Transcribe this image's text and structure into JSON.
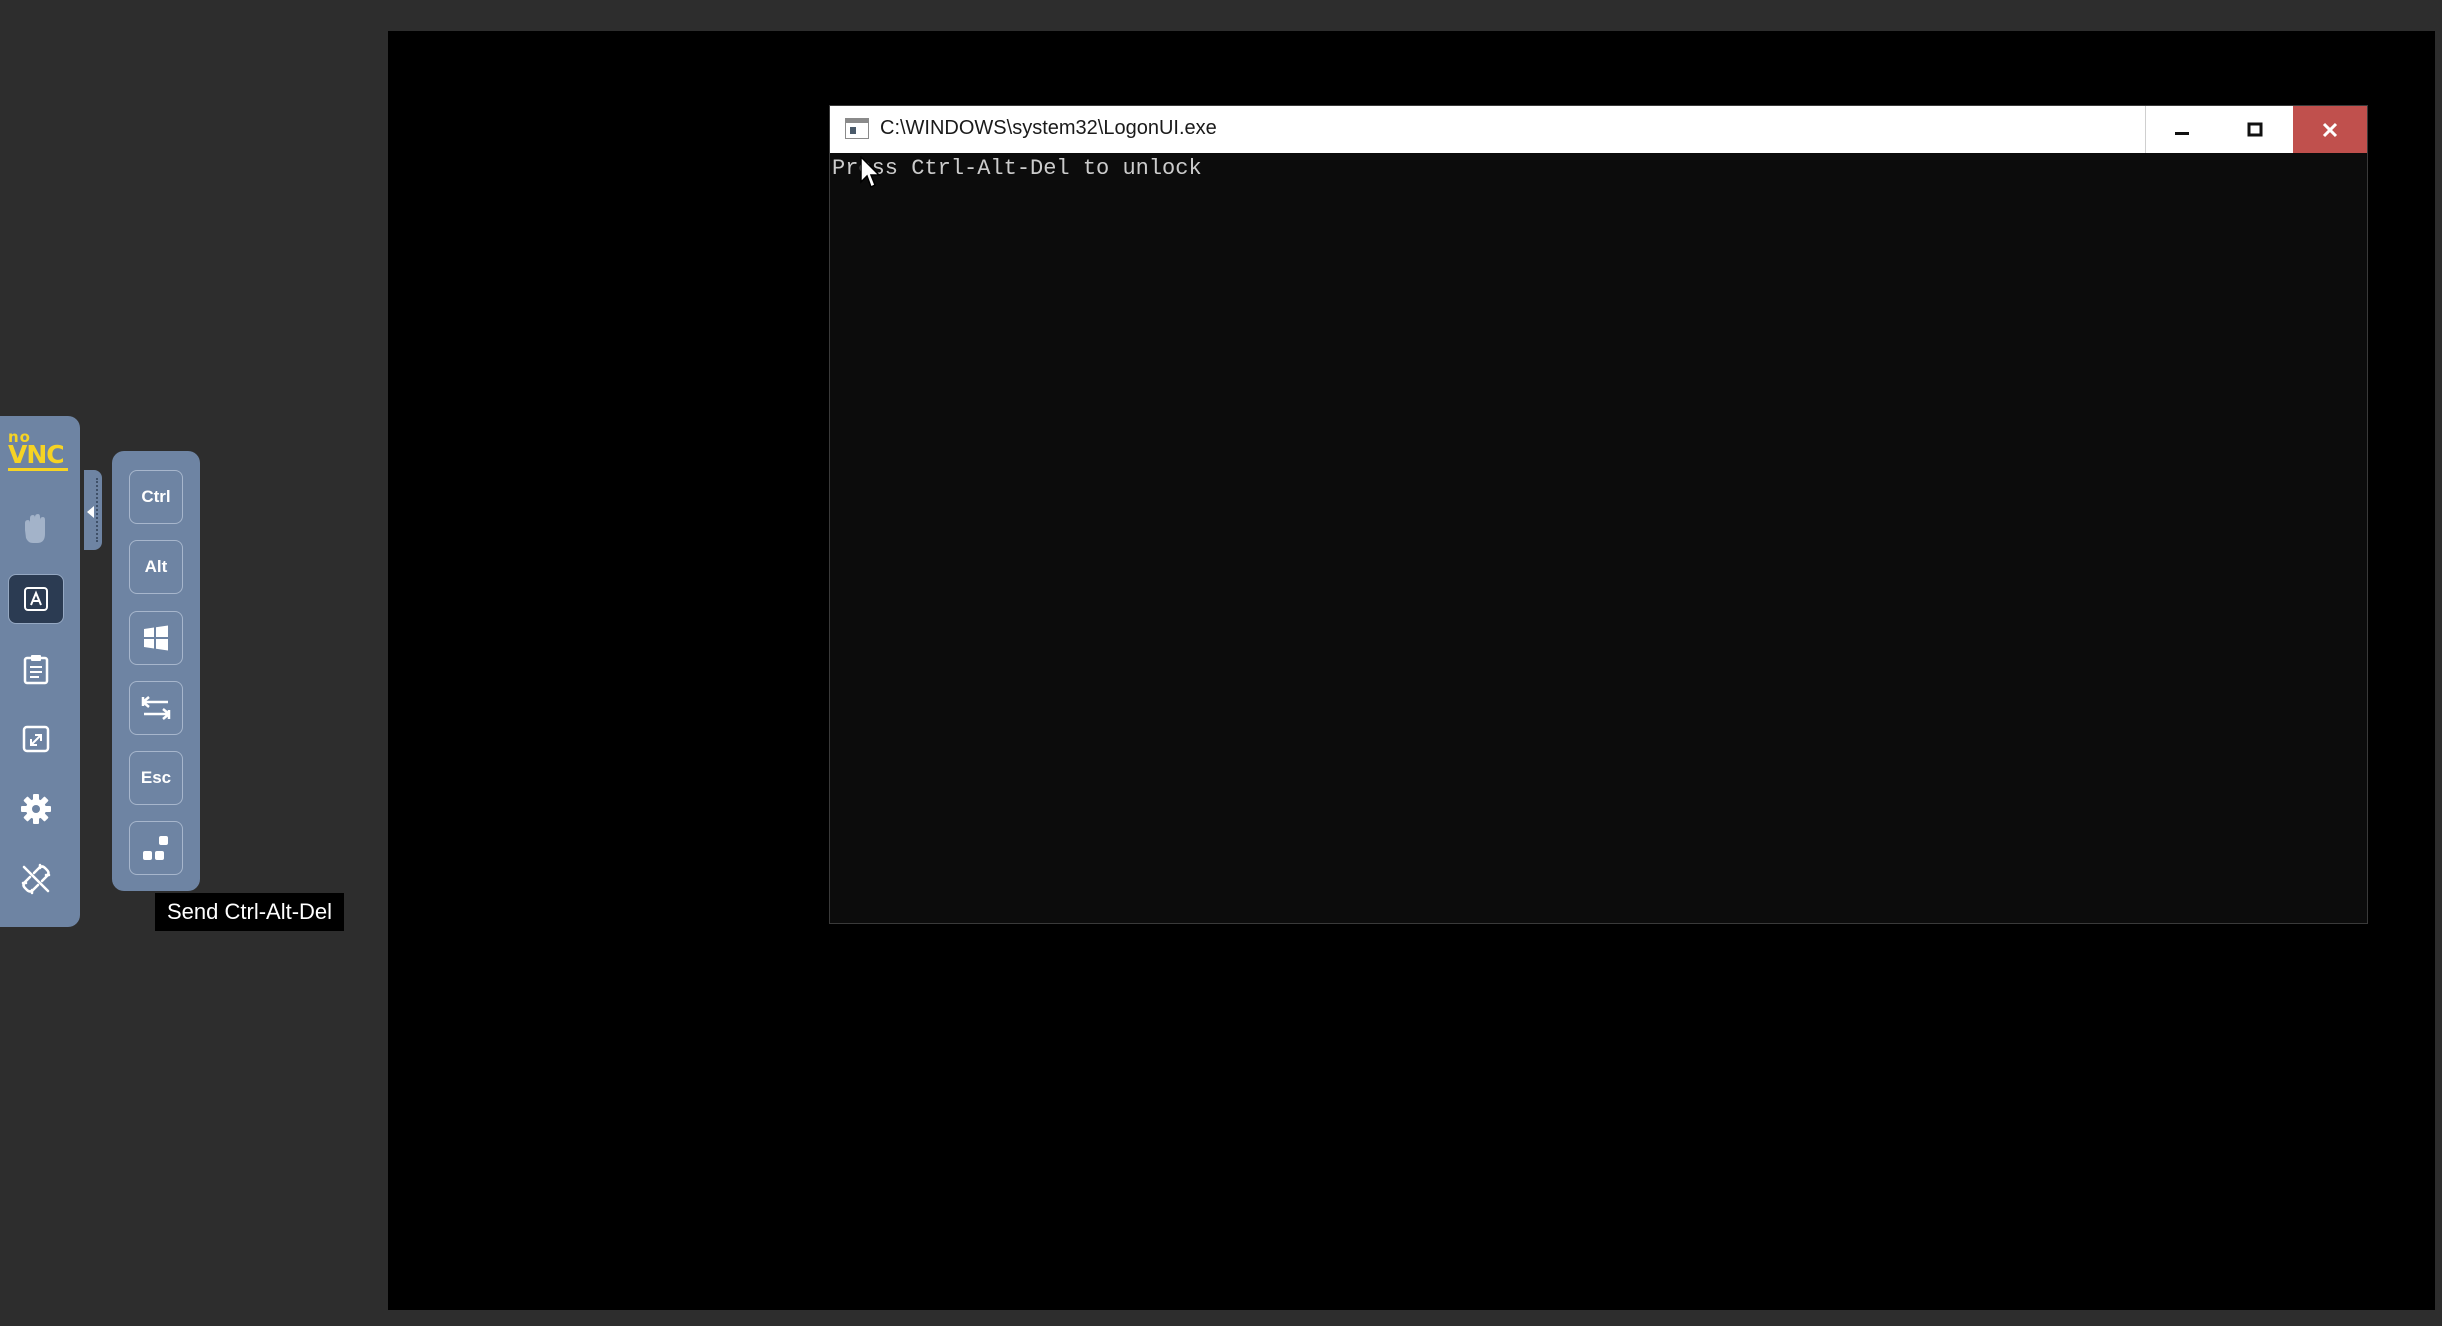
{
  "window": {
    "title": "C:\\WINDOWS\\system32\\LogonUI.exe",
    "minimize_icon": "minimize-icon",
    "maximize_icon": "maximize-icon",
    "close_icon": "close-icon"
  },
  "console": {
    "text": "Press Ctrl-Alt-Del to unlock"
  },
  "novnc": {
    "logo_top": "no",
    "logo_bottom": "VNC",
    "buttons": [
      {
        "name": "drag-viewport",
        "icon": "hand-icon"
      },
      {
        "name": "keyboard",
        "icon": "keyboard-icon",
        "active": true
      },
      {
        "name": "clipboard",
        "icon": "clipboard-icon"
      },
      {
        "name": "fullscreen",
        "icon": "fullscreen-icon"
      },
      {
        "name": "settings",
        "icon": "gear-icon"
      },
      {
        "name": "disconnect",
        "icon": "disconnect-icon"
      }
    ]
  },
  "extra_keys": {
    "ctrl": "Ctrl",
    "alt": "Alt",
    "windows_icon": "windows-icon",
    "tab_icon": "tab-icon",
    "esc": "Esc",
    "ctrl_alt_del_icon": "ctrl-alt-del-icon"
  },
  "tooltip": {
    "text": "Send Ctrl-Alt-Del"
  }
}
